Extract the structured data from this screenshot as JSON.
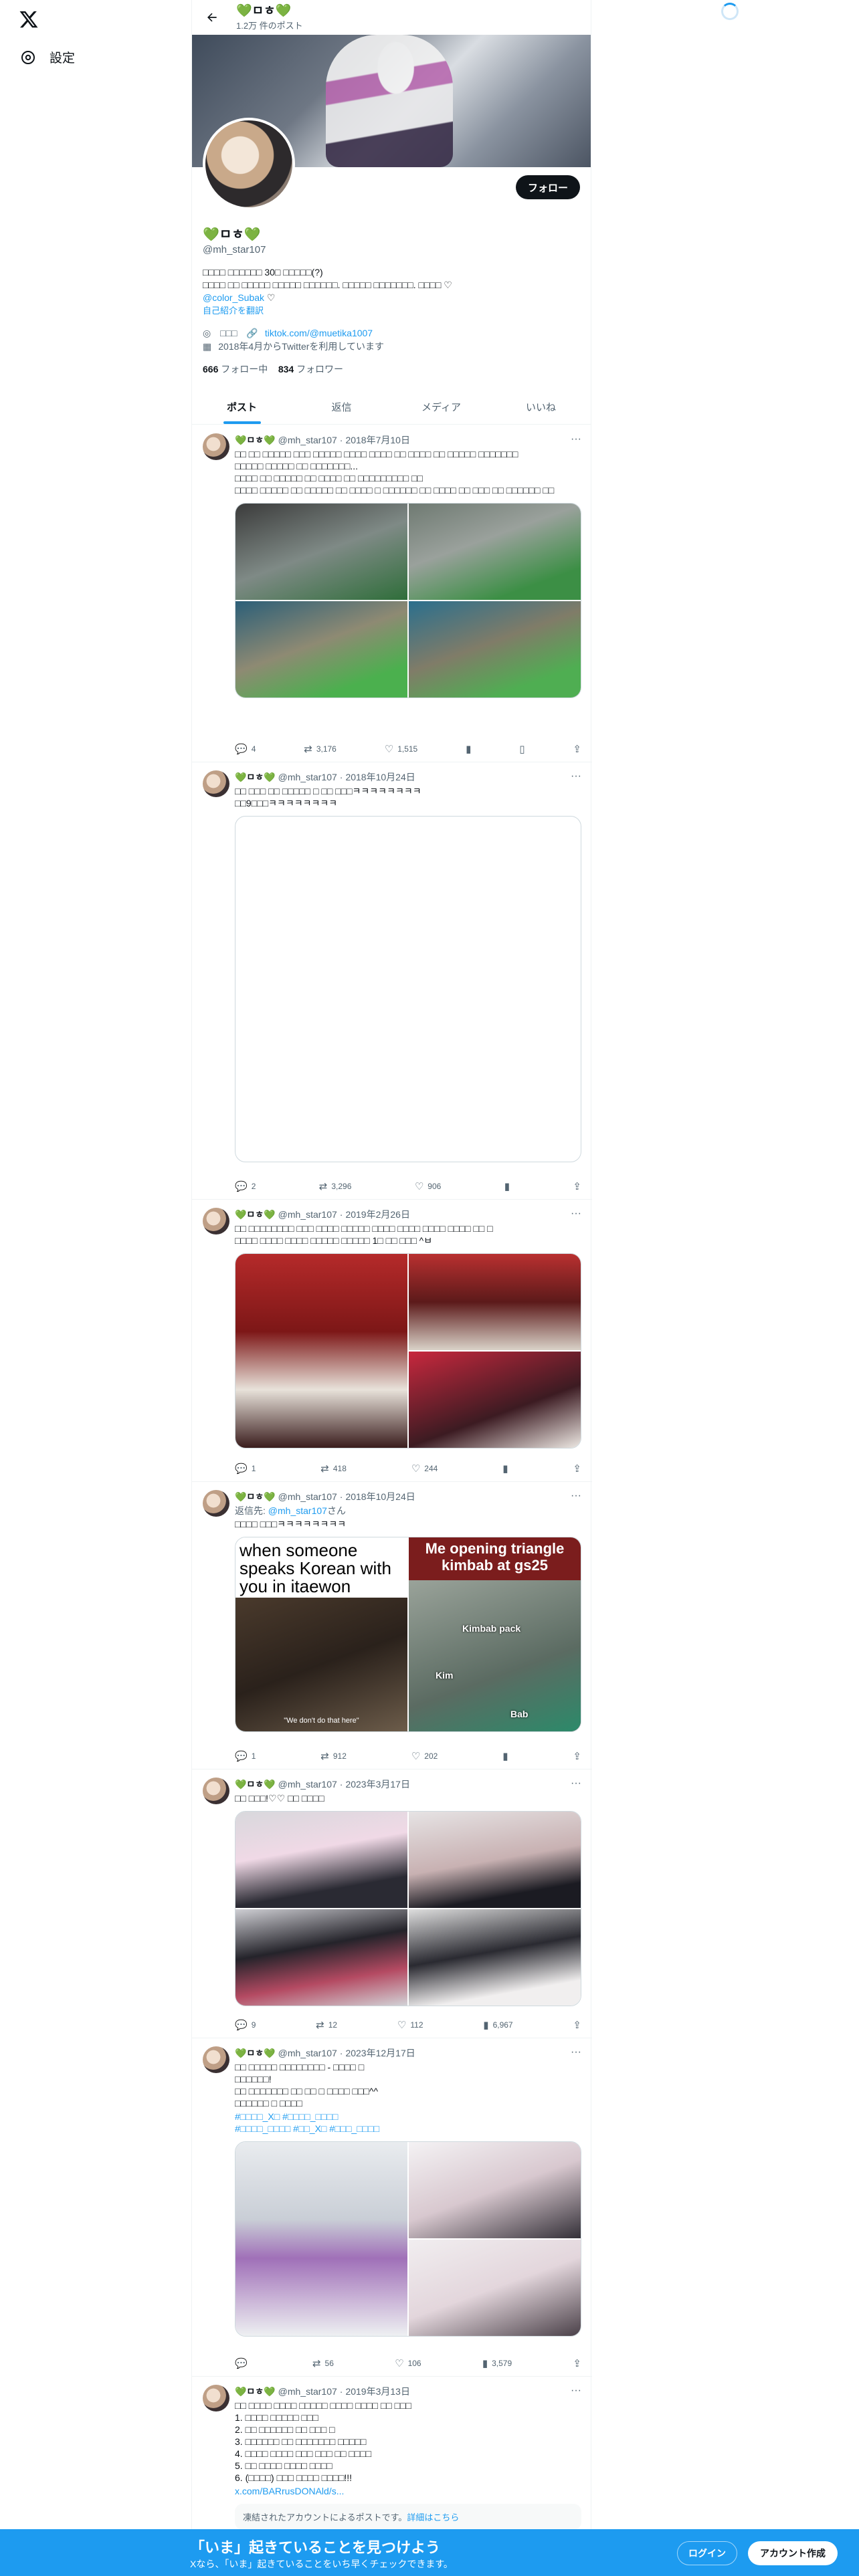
{
  "nav": {
    "settings": "設定"
  },
  "header": {
    "name": "💚ㅁㅎ💚",
    "post_count": "1.2万 件のポスト"
  },
  "profile": {
    "name": "💚ㅁㅎ💚",
    "handle": "@mh_star107",
    "follow_label": "フォロー",
    "bio_line1": "□□□□ □□□□□□ 30□ □□□□□(?)",
    "bio_line2": "□□□□ □□ □□□□□ □□□□□ □□□□□□. □□□□□ □□□□□□□. □□□□ ♡",
    "bio_mention": "@color_Subak",
    "bio_translate": "自己紹介を翻訳",
    "location": "□□□",
    "website": "tiktok.com/@muetika1007",
    "joined": "2018年4月からTwitterを利用しています",
    "following_count": "666",
    "following_label": "フォロー中",
    "followers_count": "834",
    "followers_label": "フォロワー"
  },
  "tabs": [
    "ポスト",
    "返信",
    "メディア",
    "いいね"
  ],
  "posts": [
    {
      "name": "💚ㅁㅎ💚",
      "handle": "@mh_star107",
      "date": "2018年7月10日",
      "text": "□□ □□ □□□□□ □□□ □□□□□ □□□□ □□□□ □□ □□□□ □□ □□□□□ □□□□□□□\n□□□□□ □□□□□ □□ □□□□□□□...\n□□□□ □□ □□□□□ □□ □□□□ □□ □□□□□□□□□ □□\n□□□□ □□□□□ □□ □□□□□ □□ □□□□ □ □□□□□□ □□ □□□□ □□ □□□ □□ □□□□□□ □□",
      "replies": "4",
      "reposts": "3,176",
      "likes": "1,515",
      "views": ""
    },
    {
      "name": "💚ㅁㅎ💚",
      "handle": "@mh_star107",
      "date": "2018年10月24日",
      "text": "□□ □□□ □□ □□□□□ □ □□ □□□ㅋㅋㅋㅋㅋㅋㅋㅋ\n□□9□□□ㅋㅋㅋㅋㅋㅋㅋㅋ",
      "replies": "2",
      "reposts": "3,296",
      "likes": "906",
      "views": ""
    },
    {
      "name": "💚ㅁㅎ💚",
      "handle": "@mh_star107",
      "date": "2019年2月26日",
      "text": "□□ □□□□□□□□ □□□ □□□□ □□□□□ □□□□ □□□□ □□□□ □□□□ □□ □\n□□□□ □□□□ □□□□ □□□□□ □□□□□ 1□ □□ □□□ ^ㅂ",
      "replies": "1",
      "reposts": "418",
      "likes": "244",
      "views": ""
    },
    {
      "name": "💚ㅁㅎ💚",
      "handle": "@mh_star107",
      "date": "2018年10月24日",
      "reply_to_label": "返信先:",
      "reply_to": "@mh_star107",
      "reply_to_suffix": "さん",
      "text": "□□□□ □□□ㅋㅋㅋㅋㅋㅋㅋㅋ",
      "meme_left": "when someone speaks Korean with you in itaewon",
      "meme_left_sub": "\"We don't do that here\"",
      "meme_right": "Me opening triangle kimbab at gs25",
      "meme_labels": [
        "Kimbab pack",
        "Kim",
        "Bab"
      ],
      "replies": "1",
      "reposts": "912",
      "likes": "202",
      "views": ""
    },
    {
      "name": "💚ㅁㅎ💚",
      "handle": "@mh_star107",
      "date": "2023年3月17日",
      "text": "□□ □□□!♡♡ □□ □□□□",
      "replies": "9",
      "reposts": "12",
      "likes": "112",
      "views": "6,967"
    },
    {
      "name": "💚ㅁㅎ💚",
      "handle": "@mh_star107",
      "date": "2023年12月17日",
      "text": "□□ □□□□□ □□□□□□□□ - □□□□ □\n□□□□□□!\n□□ □□□□□□□ □□ □□ □ □□□□ □□□^^\n□□□□□□ □ □□□□",
      "tags": "#□□□□_X□ #□□□□_□□□□\n#□□□□_□□□□ #□□_X□ #□□□_□□□□",
      "replies": "",
      "reposts": "56",
      "likes": "106",
      "views": "3,579"
    },
    {
      "name": "💚ㅁㅎ💚",
      "handle": "@mh_star107",
      "date": "2019年3月13日",
      "text": "□□ □□□□ □□□□ □□□□□ □□□□ □□□□ □□ □□□\n1. □□□□ □□□□□ □□□\n2. □□ □□□□□□ □□ □□□ □\n3. □□□□□□ □□ □□□□□□□ □□□□□\n4. □□□□ □□□□ □□□ □□□ □□ □□□□\n5. □□ □□□□ □□□□ □□□□\n6. (□□□□) □□□ □□□□ □□□□!!!",
      "link": "x.com/BARrusDONAld/s...",
      "quoted": "凍結されたアカウントによるポストです。",
      "quoted_link": "詳細はこちら"
    }
  ],
  "footer": {
    "title": "「いま」起きていることを見つけよう",
    "subtitle": "Xなら、「いま」起きていることをいち早くチェックできます。",
    "login": "ログイン",
    "signup": "アカウント作成"
  },
  "colors": {
    "accent": "#1d9bf0",
    "heart": "#4caf3a"
  }
}
